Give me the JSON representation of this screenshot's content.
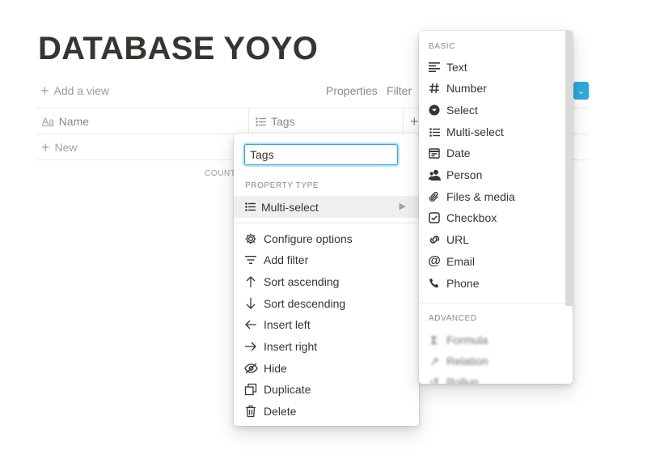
{
  "page": {
    "title": "DATABASE YOYO"
  },
  "toolbar": {
    "add_view": "Add a view",
    "properties": "Properties",
    "filter": "Filter"
  },
  "table": {
    "columns": [
      {
        "label": "Name",
        "type_glyph": "Aa"
      },
      {
        "label": "Tags"
      }
    ],
    "new_row": "New",
    "count_label": "COUNT"
  },
  "property_menu": {
    "name_value": "Tags",
    "type_section": "PROPERTY TYPE",
    "current_type": "Multi-select",
    "items": [
      {
        "label": "Configure options",
        "icon": "gear-icon"
      },
      {
        "label": "Add filter",
        "icon": "filter-icon"
      },
      {
        "label": "Sort ascending",
        "icon": "arrow-up-icon"
      },
      {
        "label": "Sort descending",
        "icon": "arrow-down-icon"
      },
      {
        "label": "Insert left",
        "icon": "arrow-left-icon"
      },
      {
        "label": "Insert right",
        "icon": "arrow-right-icon"
      },
      {
        "label": "Hide",
        "icon": "eye-off-icon"
      },
      {
        "label": "Duplicate",
        "icon": "duplicate-icon"
      },
      {
        "label": "Delete",
        "icon": "trash-icon"
      }
    ]
  },
  "type_menu": {
    "basic_label": "BASIC",
    "basic": [
      {
        "label": "Text",
        "icon": "text-icon"
      },
      {
        "label": "Number",
        "icon": "number-icon"
      },
      {
        "label": "Select",
        "icon": "select-icon"
      },
      {
        "label": "Multi-select",
        "icon": "multi-select-icon"
      },
      {
        "label": "Date",
        "icon": "calendar-icon"
      },
      {
        "label": "Person",
        "icon": "person-icon"
      },
      {
        "label": "Files & media",
        "icon": "paperclip-icon"
      },
      {
        "label": "Checkbox",
        "icon": "checkbox-icon"
      },
      {
        "label": "URL",
        "icon": "link-icon"
      },
      {
        "label": "Email",
        "icon": "at-icon"
      },
      {
        "label": "Phone",
        "icon": "phone-icon"
      }
    ],
    "advanced_label": "ADVANCED",
    "advanced": [
      {
        "label": "Formula",
        "icon": "formula-icon"
      },
      {
        "label": "Relation",
        "icon": "relation-icon"
      },
      {
        "label": "Rollup",
        "icon": "rollup-icon"
      }
    ]
  },
  "colors": {
    "accent": "#2eaadc",
    "text": "#37352f",
    "muted": "#9b9a97"
  }
}
